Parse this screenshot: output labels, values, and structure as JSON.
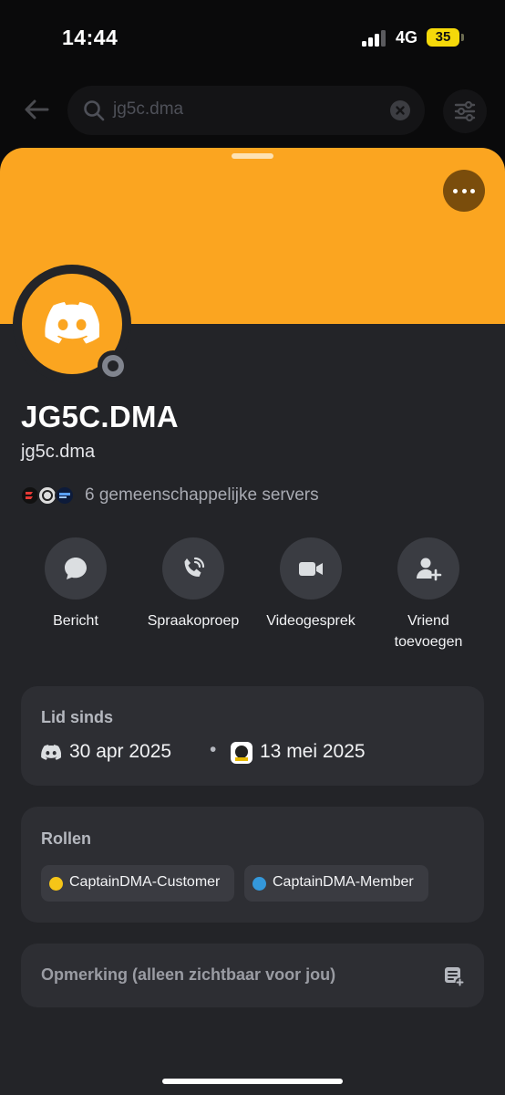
{
  "status_bar": {
    "time": "14:44",
    "network": "4G",
    "battery": "35"
  },
  "search": {
    "query": "jg5c.dma"
  },
  "profile": {
    "banner_color": "#fba520",
    "display_name": "JG5C.DMA",
    "username": "jg5c.dma",
    "status": "offline",
    "mutual_servers": "6 gemeenschappelijke servers"
  },
  "actions": [
    {
      "label": "Bericht",
      "icon": "message-bubble-icon"
    },
    {
      "label": "Spraakoproep",
      "icon": "phone-call-icon"
    },
    {
      "label": "Videogesprek",
      "icon": "video-camera-icon"
    },
    {
      "label": "Vriend toevoegen",
      "icon": "add-friend-icon"
    }
  ],
  "member_since": {
    "title": "Lid sinds",
    "discord_date": "30 apr 2025",
    "server_date": "13 mei 2025"
  },
  "roles": {
    "title": "Rollen",
    "items": [
      {
        "name": "CaptainDMA-Customer",
        "color": "#f5c518"
      },
      {
        "name": "CaptainDMA-Member",
        "color": "#3498db"
      }
    ]
  },
  "note": {
    "placeholder": "Opmerking (alleen zichtbaar voor jou)"
  }
}
